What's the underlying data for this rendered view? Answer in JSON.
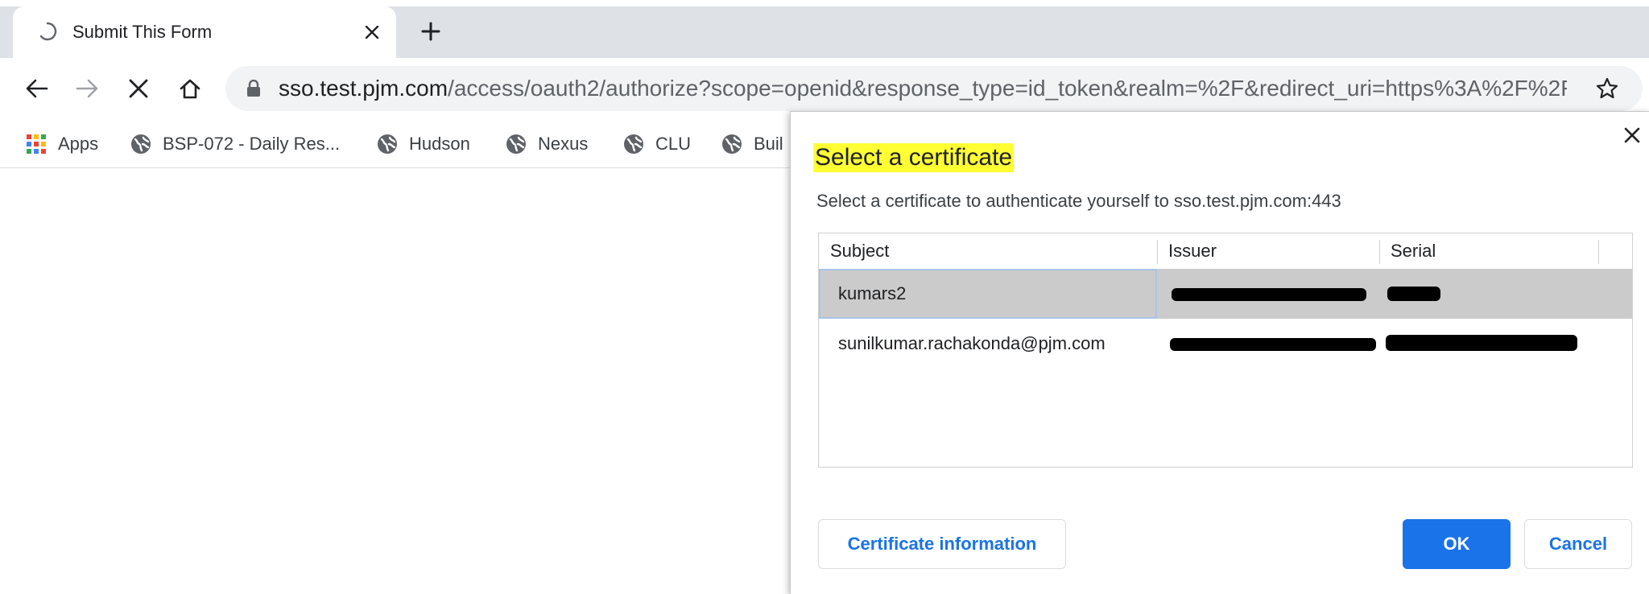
{
  "tab": {
    "title": "Submit This Form"
  },
  "toolbar": {
    "url_host": "sso.test.pjm.com",
    "url_path": "/access/oauth2/authorize?scope=openid&response_type=id_token&realm=%2F&redirect_uri=https%3A%2F%2Fe..."
  },
  "bookmarks": [
    {
      "label": "Apps",
      "icon": "apps-grid-icon"
    },
    {
      "label": "BSP-072 - Daily Res...",
      "icon": "globe-icon"
    },
    {
      "label": "Hudson",
      "icon": "globe-icon"
    },
    {
      "label": "Nexus",
      "icon": "globe-icon"
    },
    {
      "label": "CLU",
      "icon": "globe-icon"
    },
    {
      "label": "Buil",
      "icon": "globe-icon"
    }
  ],
  "dialog": {
    "title": "Select a certificate",
    "subtitle": "Select a certificate to authenticate yourself to sso.test.pjm.com:443",
    "columns": {
      "subject": "Subject",
      "issuer": "Issuer",
      "serial": "Serial"
    },
    "rows": [
      {
        "subject": "kumars2",
        "issuer": "",
        "serial": "",
        "selected": true
      },
      {
        "subject": "sunilkumar.rachakonda@pjm.com",
        "issuer": "",
        "serial": "",
        "selected": false
      }
    ],
    "buttons": {
      "certificate_info": "Certificate information",
      "ok": "OK",
      "cancel": "Cancel"
    }
  },
  "colors": {
    "accent": "#1a73e8",
    "title_highlight": "#ffff33",
    "selected_row": "#cbcbcb"
  }
}
